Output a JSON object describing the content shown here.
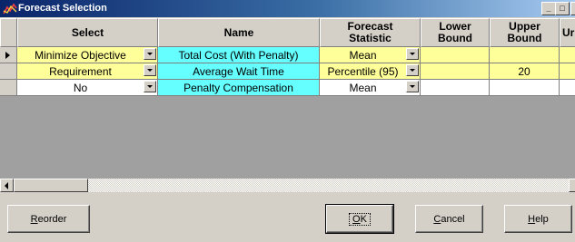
{
  "window": {
    "title": "Forecast Selection",
    "icon": "chart-line-icon"
  },
  "titlebar_buttons": {
    "minimize": "_",
    "maximize": "□",
    "close": "x"
  },
  "columns": [
    {
      "label": "Select"
    },
    {
      "label": "Name"
    },
    {
      "label": "Forecast Statistic"
    },
    {
      "label": "Lower Bound"
    },
    {
      "label": "Upper Bound"
    },
    {
      "label": "Ur"
    }
  ],
  "rows": [
    {
      "current": true,
      "select": "Minimize Objective",
      "name": "Total Cost (With Penalty)",
      "statistic": "Mean",
      "lower": "",
      "upper": "",
      "row_color": "#ffff99"
    },
    {
      "current": false,
      "select": "Requirement",
      "name": "Average Wait Time",
      "statistic": "Percentile (95)",
      "lower": "",
      "upper": "20",
      "row_color": "#ffff99"
    },
    {
      "current": false,
      "select": "No",
      "name": "Penalty Compensation",
      "statistic": "Mean",
      "lower": "",
      "upper": "",
      "row_color": "#ffffff"
    }
  ],
  "colors": {
    "name_column": "#66ffff",
    "selected_row": "#ffff99"
  },
  "buttons": {
    "reorder": {
      "mnemonic": "R",
      "rest": "eorder"
    },
    "ok": {
      "mnemonic": "O",
      "rest": "K"
    },
    "cancel": {
      "mnemonic": "C",
      "rest": "ancel"
    },
    "help": {
      "mnemonic": "H",
      "rest": "elp"
    }
  }
}
